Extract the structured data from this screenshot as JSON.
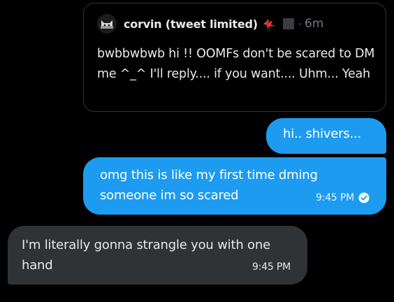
{
  "quoted_tweet": {
    "author": "corvin (tweet limited)",
    "avatar_icon": "cat-avatar",
    "badge_icons": [
      "cardinal-bird-icon",
      "gray-square-icon"
    ],
    "separator": "·",
    "time_ago": "6m",
    "text": "bwbbwbwb hi !! OOMFs don't be scared to DM me ^_^ I'll reply.... if you want.... Uhm... Yeah"
  },
  "messages": [
    {
      "direction": "sent",
      "text": "hi.. shivers..."
    },
    {
      "direction": "sent",
      "text": "omg this is like my first time dming someone im so scared",
      "time": "9:45 PM",
      "status_icon": "seen-check-icon"
    },
    {
      "direction": "received",
      "text": "I'm literally gonna strangle you with one hand",
      "time": "9:45 PM"
    }
  ],
  "colors": {
    "background": "#000000",
    "sent_bubble": "#1d9bf0",
    "received_bubble": "#2f3336",
    "quote_border": "#2f3336",
    "muted_text": "#71767b"
  }
}
